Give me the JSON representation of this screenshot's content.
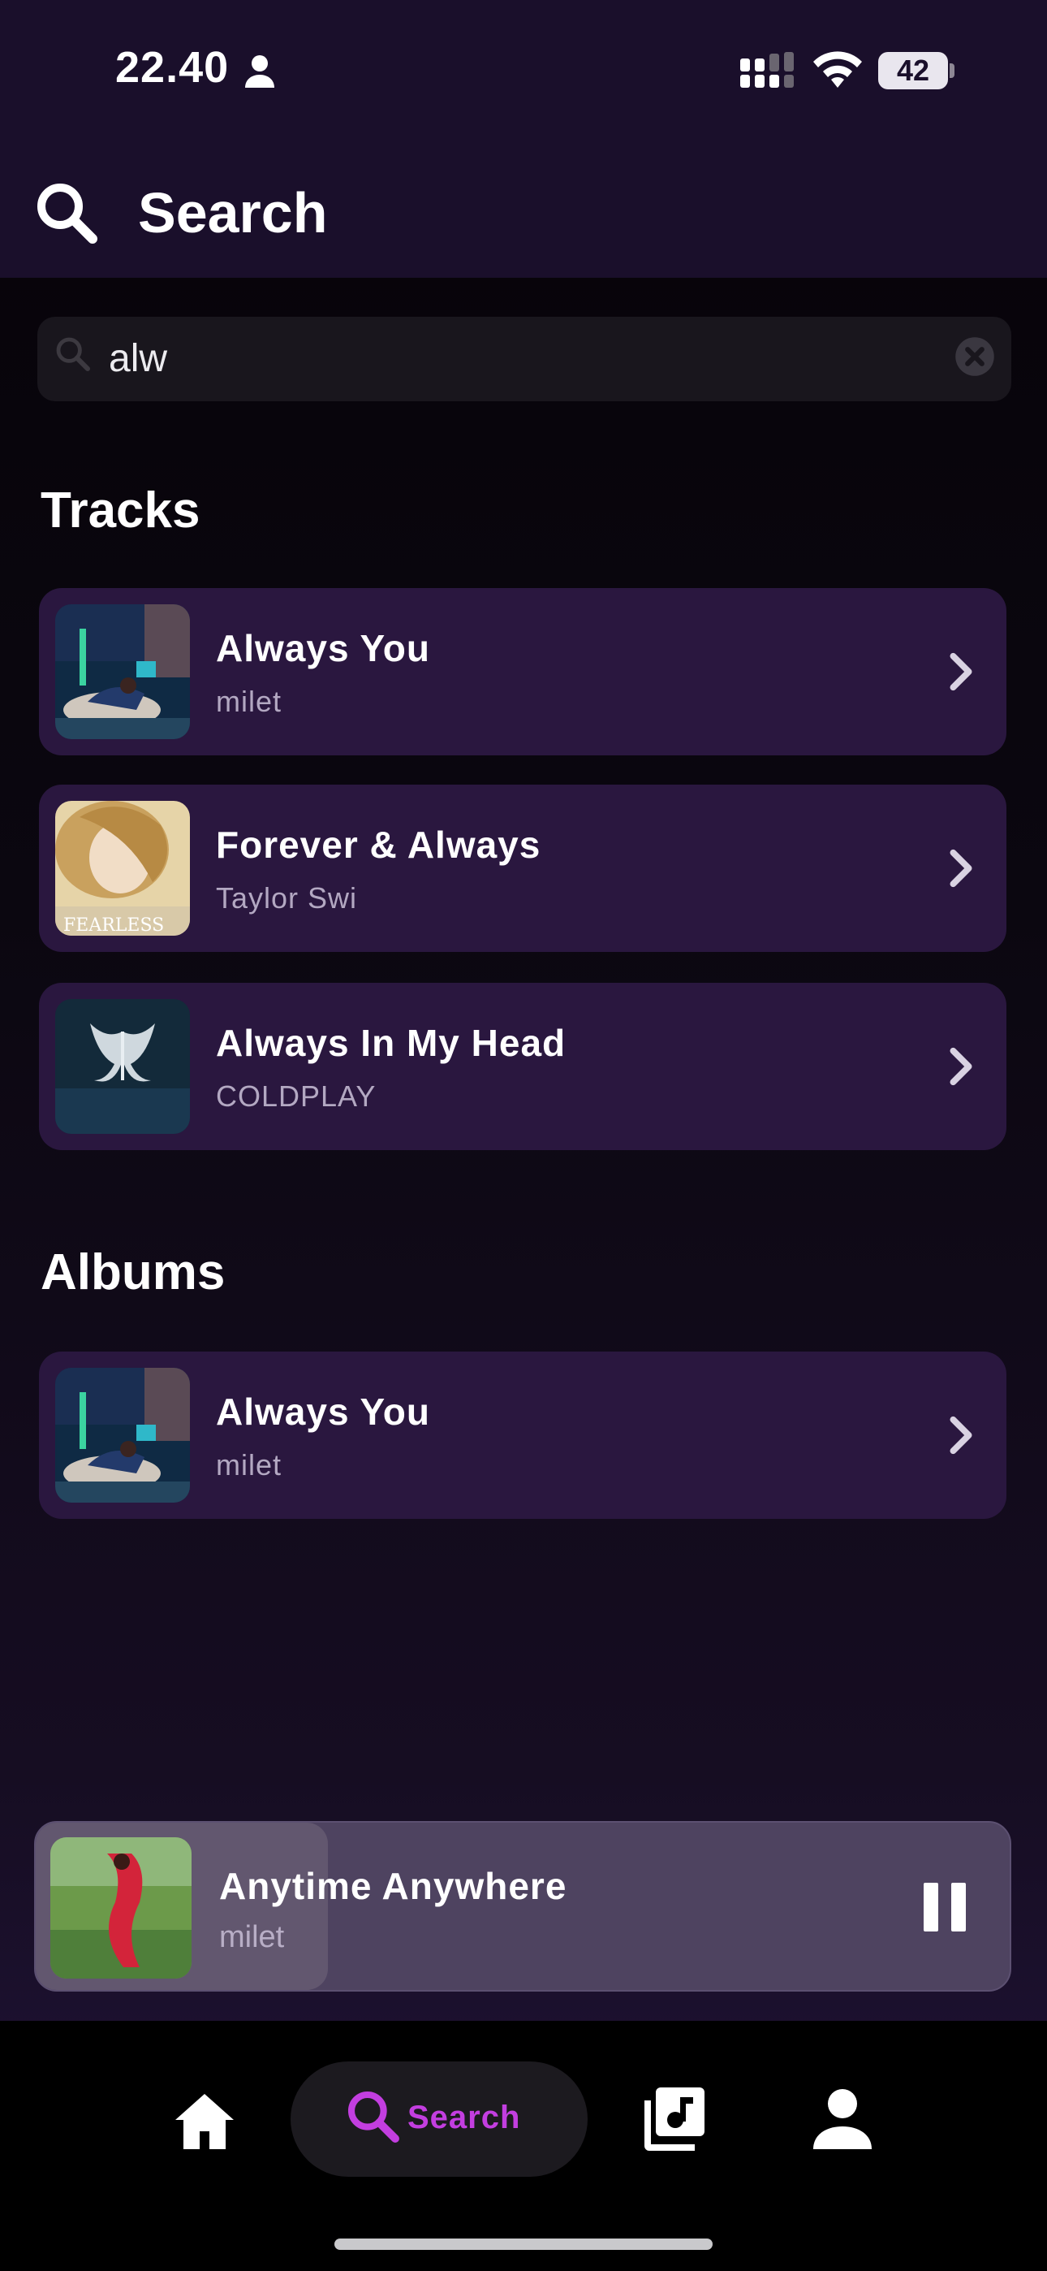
{
  "status_bar": {
    "time": "22.40",
    "battery": "42"
  },
  "header": {
    "title": "Search"
  },
  "search": {
    "query": "alw",
    "placeholder": ""
  },
  "sections": {
    "tracks_title": "Tracks",
    "albums_title": "Albums"
  },
  "tracks": [
    {
      "title": "Always You",
      "artist": "milet"
    },
    {
      "title": "Forever & Always",
      "artist": "Taylor Swi"
    },
    {
      "title": "Always In My Head",
      "artist": "COLDPLAY"
    }
  ],
  "albums": [
    {
      "title": "Always You",
      "artist": "milet"
    }
  ],
  "now_playing": {
    "title": "Anytime Anywhere",
    "artist": "milet",
    "progress": 0.3
  },
  "nav": {
    "search_label": "Search",
    "active": "search"
  },
  "colors": {
    "accent": "#c33ee0",
    "card": "#2a173f",
    "header": "#1a0f2b"
  }
}
